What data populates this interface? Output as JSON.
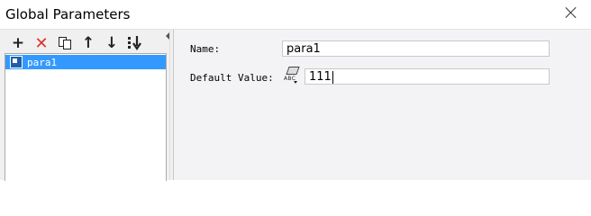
{
  "window": {
    "title": "Global Parameters"
  },
  "toolbar": {
    "add_glyph": "+",
    "delete_glyph": "✕",
    "copy_glyph": "⧉",
    "up_glyph": "↑",
    "down_glyph": "↓",
    "sort_glyph": "⇊"
  },
  "parameters": {
    "items": [
      {
        "label": "para1",
        "selected": true
      }
    ]
  },
  "form": {
    "name_label": "Name:",
    "name_value": "para1",
    "default_label": "Default Value:",
    "default_value": "111",
    "type_icon_text": "ABC"
  },
  "colors": {
    "selection": "#3399ff",
    "delete": "#d9342b"
  }
}
